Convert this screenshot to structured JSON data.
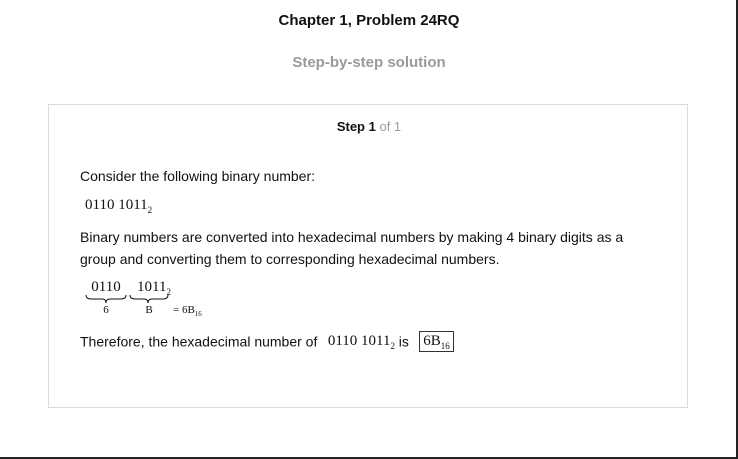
{
  "header": {
    "chapter_title": "Chapter 1, Problem 24RQ",
    "subtitle": "Step-by-step solution"
  },
  "step": {
    "label": "Step 1",
    "of_text": "of 1"
  },
  "content": {
    "intro": "Consider the following binary number:",
    "binary_main": "0110 1011",
    "binary_base": "2",
    "explanation": "Binary numbers are converted into hexadecimal numbers by making 4 binary digits as a group and converting them to corresponding hexadecimal numbers.",
    "group1_bits": "0110",
    "group2_bits": "1011",
    "group2_base": "2",
    "group1_hex": "6",
    "group2_hex": "B",
    "equals_text": "= 6B",
    "equals_base": "16",
    "therefore_prefix": "Therefore, the hexadecimal number of",
    "therefore_binary": "0110 1011",
    "therefore_binary_base": "2",
    "therefore_is": "is",
    "answer_value": "6B",
    "answer_base": "16"
  }
}
